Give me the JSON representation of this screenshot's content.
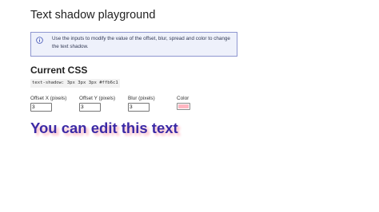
{
  "page": {
    "title": "Text shadow playground"
  },
  "info": {
    "text": "Use the inputs to modify the value of the offset, blur, spread and color to change the text shadow.",
    "icon": "info-circle-icon"
  },
  "current_css": {
    "heading": "Current CSS",
    "code": "text-shadow: 3px 3px 3px #ffb6c1"
  },
  "controls": {
    "offset_x": {
      "label": "Offset X (pixels)",
      "value": "3"
    },
    "offset_y": {
      "label": "Offset Y (pixels)",
      "value": "3"
    },
    "blur": {
      "label": "Blur (pixels)",
      "value": "3"
    },
    "color": {
      "label": "Color",
      "value": "#ffb6c1"
    }
  },
  "demo": {
    "text": "You can edit this text",
    "text_color": "#3b2aa6"
  },
  "colors": {
    "info_background": "#eef1fb",
    "info_border": "#8e96d0",
    "info_icon": "#3f51b5"
  }
}
